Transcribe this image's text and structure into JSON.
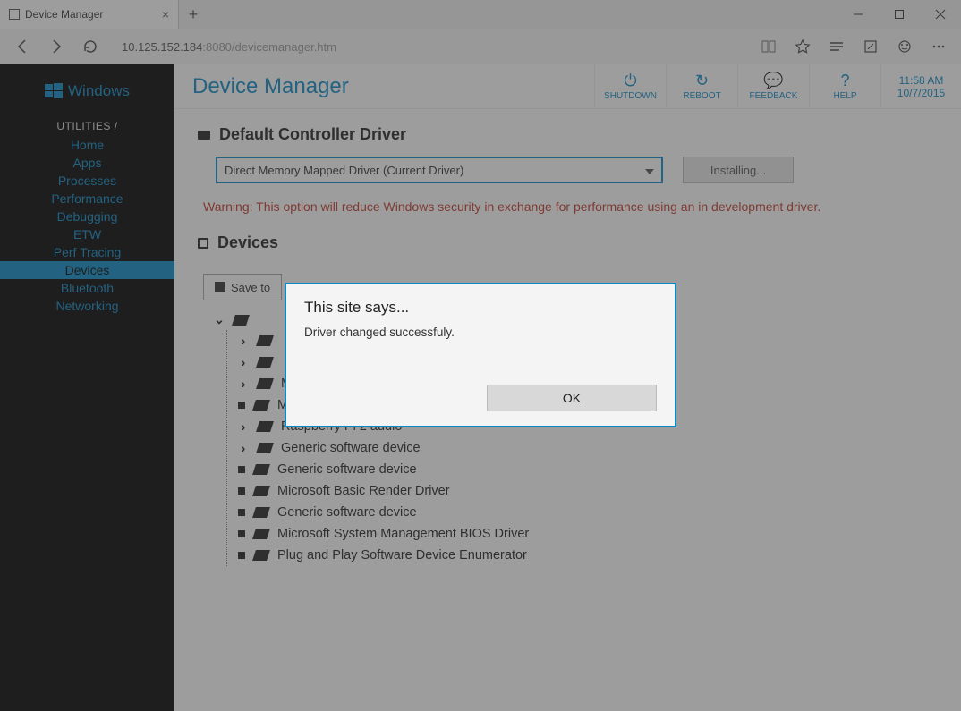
{
  "browser": {
    "tab_title": "Device Manager",
    "url_prefix": "10.125.152.184",
    "url_suffix": ":8080/devicemanager.htm"
  },
  "sidebar": {
    "logo_text": "Windows",
    "heading": "UTILITIES /",
    "items": [
      "Home",
      "Apps",
      "Processes",
      "Performance",
      "Debugging",
      "ETW",
      "Perf Tracing",
      "Devices",
      "Bluetooth",
      "Networking"
    ],
    "active_index": 7
  },
  "header": {
    "title": "Device Manager",
    "buttons": [
      {
        "id": "shutdown",
        "label": "SHUTDOWN",
        "icon": "power-icon",
        "glyph": "⏻"
      },
      {
        "id": "reboot",
        "label": "REBOOT",
        "icon": "refresh-icon",
        "glyph": "↻"
      },
      {
        "id": "feedback",
        "label": "FEEDBACK",
        "icon": "chat-icon",
        "glyph": "💬"
      },
      {
        "id": "help",
        "label": "HELP",
        "icon": "help-icon",
        "glyph": "?"
      }
    ],
    "time": "11:58 AM",
    "date": "10/7/2015"
  },
  "driver_section": {
    "title": "Default Controller Driver",
    "select_value": "Direct Memory Mapped Driver (Current Driver)",
    "install_label": "Installing...",
    "warning": "Warning: This option will reduce Windows security in exchange for performance using an in development driver."
  },
  "devices_section": {
    "title": "Devices",
    "save_label": "Save to",
    "tree": [
      {
        "expander": ">",
        "label": ""
      },
      {
        "expander": ">",
        "label": ""
      },
      {
        "expander": ">",
        "label": "Microsoft Basic Display Driver"
      },
      {
        "bullet": true,
        "label": "Microsoft Kernel Debug Network Adapter"
      },
      {
        "expander": ">",
        "label": "Raspberry Pi 2 audio"
      },
      {
        "expander": ">",
        "label": "Generic software device"
      },
      {
        "bullet": true,
        "label": "Generic software device"
      },
      {
        "bullet": true,
        "label": "Microsoft Basic Render Driver"
      },
      {
        "bullet": true,
        "label": "Generic software device"
      },
      {
        "bullet": true,
        "label": "Microsoft System Management BIOS Driver"
      },
      {
        "bullet": true,
        "label": "Plug and Play Software Device Enumerator"
      }
    ]
  },
  "dialog": {
    "title": "This site says...",
    "message": "Driver changed successfuly.",
    "ok": "OK"
  }
}
